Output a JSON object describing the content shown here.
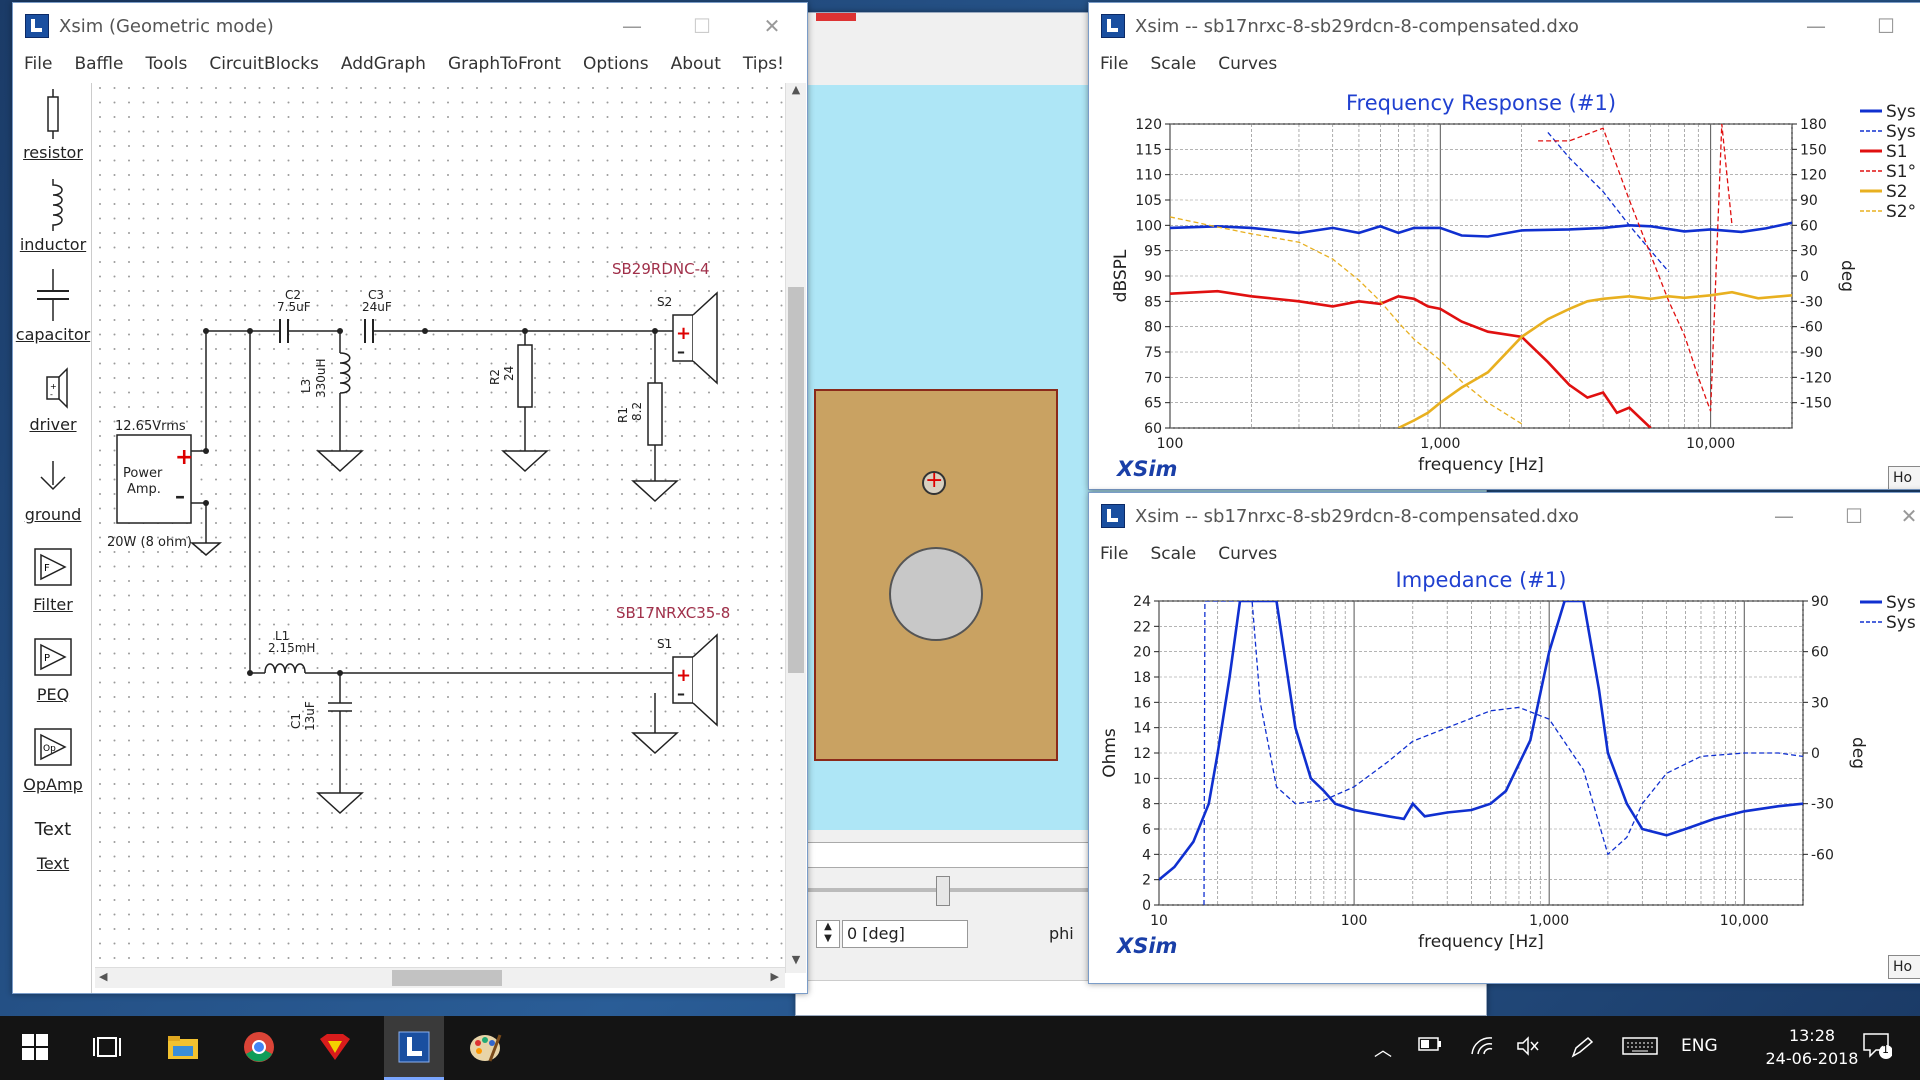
{
  "editor": {
    "title": "Xsim (Geometric mode)",
    "menu": [
      "File",
      "Baffle",
      "Tools",
      "CircuitBlocks",
      "AddGraph",
      "GraphToFront",
      "Options",
      "About",
      "Tips!"
    ],
    "palette": [
      "resistor",
      "inductor",
      "capacitor",
      "driver",
      "ground",
      "Filter",
      "PEQ",
      "OpAmp",
      "Text",
      "Text"
    ],
    "components": {
      "amp_voltage": "12.65Vrms",
      "amp_name_1": "Power",
      "amp_name_2": "Amp.",
      "amp_rating": "20W (8 ohm)",
      "c2_name": "C2",
      "c2_value": "7.5uF",
      "c3_name": "C3",
      "c3_value": "24uF",
      "l3_name": "L3",
      "l3_value": "330uH",
      "r2_name": "R2",
      "r2_value": "24",
      "r1_name": "R1",
      "r1_value": "8.2",
      "l1_name": "L1",
      "l1_value": "2.15mH",
      "c1_name": "C1",
      "c1_value": "13uF",
      "s2_label": "S2",
      "s2_model": "SB29RDNC-4",
      "s1_label": "S1",
      "s1_model": "SB17NRXC35-8"
    }
  },
  "baffle": {
    "angle_value": "0 [deg]",
    "phi_label": "phi"
  },
  "fr_window": {
    "title": "Xsim -- sb17nrxc-8-sb29rdcn-8-compensated.dxo",
    "menu": [
      "File",
      "Scale",
      "Curves"
    ],
    "brand": "XSim",
    "corner_button": "Ho",
    "chart_data": {
      "type": "line",
      "title": "Frequency Response (#1)",
      "xlabel": "frequency [Hz]",
      "ylabel": "dBSPL",
      "y2label": "deg",
      "xscale": "log",
      "xlim": [
        100,
        20000
      ],
      "ylim": [
        60,
        120
      ],
      "y2lim": [
        -180,
        180
      ],
      "x_ticks": [
        "100",
        "1,000",
        "10,000"
      ],
      "y_ticks": [
        "120",
        "115",
        "110",
        "105",
        "100",
        "95",
        "90",
        "85",
        "80",
        "75",
        "70",
        "65",
        "60"
      ],
      "y2_ticks": [
        "180",
        "150",
        "120",
        "90",
        "60",
        "30",
        "0",
        "-30",
        "-60",
        "-90",
        "-120",
        "-150"
      ],
      "grid": true,
      "legend_position": "right",
      "legend": [
        "Sys",
        "Sys",
        "S1",
        "S1°",
        "S2",
        "S2°"
      ],
      "series": [
        {
          "name": "Sys",
          "axis": "y",
          "color": "#1030d0",
          "style": "solid",
          "x": [
            100,
            150,
            200,
            300,
            400,
            500,
            600,
            700,
            800,
            1000,
            1200,
            1500,
            2000,
            3000,
            4000,
            5000,
            6000,
            8000,
            10000,
            13000,
            16000,
            20000
          ],
          "y": [
            99.5,
            99.8,
            99.5,
            98.5,
            99.5,
            98.5,
            99.8,
            98.5,
            99.5,
            99.5,
            98,
            97.8,
            99,
            99.2,
            99.5,
            100,
            99.8,
            98.8,
            99.2,
            98.7,
            99.4,
            100.5
          ]
        },
        {
          "name": "Sys",
          "axis": "y2",
          "color": "#1030d0",
          "style": "dashed",
          "x": [
            2500,
            3000,
            4000,
            5000,
            6000,
            7000
          ],
          "y": [
            170,
            140,
            100,
            60,
            30,
            5
          ]
        },
        {
          "name": "S1",
          "axis": "y",
          "color": "#e01010",
          "style": "solid",
          "x": [
            100,
            150,
            200,
            300,
            400,
            500,
            600,
            700,
            800,
            900,
            1000,
            1200,
            1500,
            2000,
            2500,
            3000,
            3500,
            4000,
            4500,
            5000,
            6000
          ],
          "y": [
            86.5,
            87,
            86,
            85,
            84,
            85,
            84.5,
            86,
            85.5,
            84,
            83.5,
            81,
            79,
            78,
            73,
            68.5,
            66,
            67,
            63,
            64,
            60
          ]
        },
        {
          "name": "S1°",
          "axis": "y2",
          "color": "#e01010",
          "style": "dashed",
          "x": [
            2300,
            3000,
            4000,
            5000,
            6000,
            7000,
            8000,
            9000,
            10000,
            11000,
            12000
          ],
          "y": [
            160,
            160,
            175,
            90,
            25,
            -30,
            -70,
            -120,
            -160,
            180,
            60
          ]
        },
        {
          "name": "S2",
          "axis": "y",
          "color": "#e8b020",
          "style": "solid",
          "x": [
            700,
            800,
            900,
            1000,
            1200,
            1500,
            2000,
            2500,
            3000,
            3500,
            4000,
            5000,
            6000,
            7000,
            8000,
            10000,
            12000,
            15000,
            20000
          ],
          "y": [
            60,
            61.5,
            63,
            65,
            68,
            71,
            78,
            81.5,
            83.5,
            85,
            85.5,
            86,
            85.5,
            86,
            85.7,
            86.2,
            86.8,
            85.6,
            86.2
          ]
        },
        {
          "name": "S2°",
          "axis": "y2",
          "color": "#e8b020",
          "style": "dashed",
          "x": [
            100,
            150,
            200,
            300,
            400,
            500,
            600,
            700,
            800,
            1000,
            1200,
            1500,
            2000
          ],
          "y": [
            70,
            58,
            50,
            40,
            20,
            -5,
            -30,
            -55,
            -75,
            -100,
            -125,
            -150,
            -175
          ]
        }
      ]
    }
  },
  "imp_window": {
    "title": "Xsim -- sb17nrxc-8-sb29rdcn-8-compensated.dxo",
    "menu": [
      "File",
      "Scale",
      "Curves"
    ],
    "brand": "XSim",
    "corner_button": "Ho",
    "chart_data": {
      "type": "line",
      "title": "Impedance (#1)",
      "xlabel": "frequency [Hz]",
      "ylabel": "Ohms",
      "y2label": "deg",
      "xscale": "log",
      "xlim": [
        10,
        20000
      ],
      "ylim": [
        0,
        24
      ],
      "y2lim": [
        -90,
        90
      ],
      "x_ticks": [
        "10",
        "100",
        "1,000",
        "10,000"
      ],
      "y_ticks": [
        "24",
        "22",
        "20",
        "18",
        "16",
        "14",
        "12",
        "10",
        "8",
        "6",
        "4",
        "2",
        "0"
      ],
      "y2_ticks": [
        "90",
        "60",
        "30",
        "0",
        "-30",
        "-60"
      ],
      "grid": true,
      "legend_position": "right",
      "legend": [
        "Sys",
        "Sys"
      ],
      "series": [
        {
          "name": "Sys",
          "axis": "y",
          "color": "#1030d0",
          "style": "solid",
          "x": [
            10,
            12,
            15,
            18,
            20,
            23,
            26,
            30,
            40,
            50,
            60,
            70,
            80,
            100,
            150,
            180,
            200,
            230,
            300,
            400,
            500,
            600,
            800,
            1000,
            1200,
            1500,
            1800,
            2000,
            2500,
            3000,
            4000,
            5000,
            7000,
            10000,
            15000,
            20000
          ],
          "y": [
            2,
            3,
            5,
            8,
            12,
            18,
            24,
            24,
            24,
            14,
            10,
            9,
            8,
            7.5,
            7,
            6.8,
            8,
            7,
            7.3,
            7.5,
            8,
            9,
            13,
            20,
            24,
            24,
            17,
            12,
            8,
            6,
            5.5,
            6,
            6.8,
            7.4,
            7.8,
            8
          ]
        },
        {
          "name": "Sys",
          "axis": "y2",
          "color": "#1030d0",
          "style": "dashed",
          "x": [
            17,
            17.2,
            30,
            33,
            40,
            50,
            70,
            100,
            150,
            200,
            300,
            500,
            700,
            1000,
            1500,
            2000,
            2500,
            3000,
            4000,
            6000,
            10000,
            15000,
            20000
          ],
          "y": [
            -90,
            90,
            90,
            30,
            -20,
            -30,
            -28,
            -20,
            -5,
            7,
            15,
            25,
            27,
            20,
            -10,
            -60,
            -50,
            -30,
            -12,
            -2,
            0,
            0,
            -2
          ]
        }
      ]
    }
  },
  "taskbar": {
    "lang": "ENG",
    "time": "13:28",
    "date": "24-06-2018",
    "notif_count": "1"
  }
}
